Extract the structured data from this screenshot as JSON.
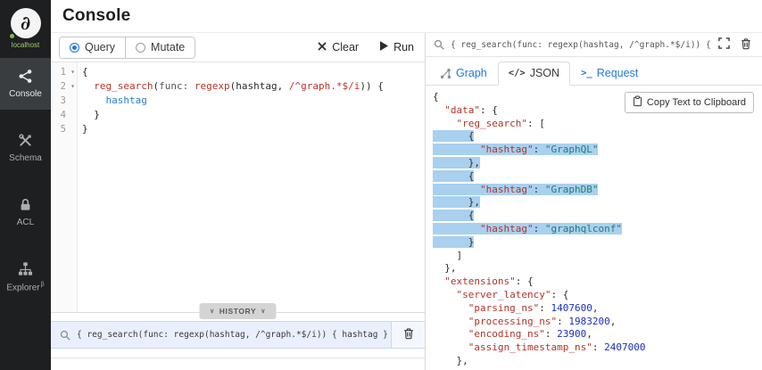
{
  "header": {
    "title": "Console"
  },
  "sidebar": {
    "server_label": "localhost",
    "items": [
      {
        "id": "console",
        "label": "Console",
        "icon": "share-network-icon",
        "active": true
      },
      {
        "id": "schema",
        "label": "Schema",
        "icon": "tools-icon",
        "active": false
      },
      {
        "id": "acl",
        "label": "ACL",
        "icon": "lock-icon",
        "active": false
      },
      {
        "id": "explorer",
        "label": "Explorer",
        "icon": "sitemap-icon",
        "active": false,
        "badge": "β"
      }
    ]
  },
  "toolbar": {
    "query_label": "Query",
    "mutate_label": "Mutate",
    "clear_label": "Clear",
    "run_label": "Run"
  },
  "editor": {
    "lines": [
      {
        "num": 1,
        "fold": true,
        "toks": [
          [
            "p",
            "{"
          ]
        ]
      },
      {
        "num": 2,
        "fold": true,
        "toks": [
          [
            "p",
            "  "
          ],
          [
            "d",
            "reg_search"
          ],
          [
            "p",
            "("
          ],
          [
            "a",
            "func:"
          ],
          [
            "p",
            " "
          ],
          [
            "d",
            "regexp"
          ],
          [
            "p",
            "(hashtag, "
          ],
          [
            "r",
            "/^graph.*$/i"
          ],
          [
            "p",
            ")) {"
          ]
        ]
      },
      {
        "num": 3,
        "fold": false,
        "toks": [
          [
            "p",
            "    "
          ],
          [
            "b",
            "hashtag"
          ]
        ]
      },
      {
        "num": 4,
        "fold": false,
        "toks": [
          [
            "p",
            "  }"
          ]
        ]
      },
      {
        "num": 5,
        "fold": false,
        "toks": [
          [
            "p",
            "}"
          ]
        ]
      }
    ]
  },
  "history": {
    "toggle_label": "HISTORY",
    "entries": [
      {
        "query": "{ reg_search(func: regexp(hashtag, /^graph.*$/i)) { hashtag } }",
        "active": true
      }
    ]
  },
  "results": {
    "query": "{ reg_search(func: regexp(hashtag, /^graph.*$/i)) { hashtag } }",
    "tabs": [
      {
        "id": "graph",
        "label": "Graph",
        "active": false,
        "icon": "graph-icon"
      },
      {
        "id": "json",
        "label": "JSON",
        "active": true,
        "glyph": "</>"
      },
      {
        "id": "request",
        "label": "Request",
        "active": false,
        "glyph": ">_"
      }
    ],
    "copy_label": "Copy Text to Clipboard",
    "json_lines": [
      {
        "hl": false,
        "toks": [
          [
            "p",
            "{"
          ]
        ]
      },
      {
        "hl": false,
        "toks": [
          [
            "p",
            "  "
          ],
          [
            "k",
            "\"data\""
          ],
          [
            "p",
            ": {"
          ]
        ]
      },
      {
        "hl": false,
        "toks": [
          [
            "p",
            "    "
          ],
          [
            "k",
            "\"reg_search\""
          ],
          [
            "p",
            ": ["
          ]
        ]
      },
      {
        "hl": true,
        "toks": [
          [
            "p",
            "      {"
          ]
        ]
      },
      {
        "hl": true,
        "toks": [
          [
            "p",
            "        "
          ],
          [
            "k",
            "\"hashtag\""
          ],
          [
            "p",
            ": "
          ],
          [
            "s",
            "\"GraphQL\""
          ]
        ]
      },
      {
        "hl": true,
        "toks": [
          [
            "p",
            "      },"
          ]
        ]
      },
      {
        "hl": true,
        "toks": [
          [
            "p",
            "      {"
          ]
        ]
      },
      {
        "hl": true,
        "toks": [
          [
            "p",
            "        "
          ],
          [
            "k",
            "\"hashtag\""
          ],
          [
            "p",
            ": "
          ],
          [
            "s",
            "\"GraphDB\""
          ]
        ]
      },
      {
        "hl": true,
        "toks": [
          [
            "p",
            "      },"
          ]
        ]
      },
      {
        "hl": true,
        "toks": [
          [
            "p",
            "      {"
          ]
        ]
      },
      {
        "hl": true,
        "toks": [
          [
            "p",
            "        "
          ],
          [
            "k",
            "\"hashtag\""
          ],
          [
            "p",
            ": "
          ],
          [
            "s",
            "\"graphqlconf\""
          ]
        ]
      },
      {
        "hl": true,
        "toks": [
          [
            "p",
            "      }"
          ]
        ]
      },
      {
        "hl": false,
        "toks": [
          [
            "p",
            "    ]"
          ]
        ]
      },
      {
        "hl": false,
        "toks": [
          [
            "p",
            "  },"
          ]
        ]
      },
      {
        "hl": false,
        "toks": [
          [
            "p",
            "  "
          ],
          [
            "k",
            "\"extensions\""
          ],
          [
            "p",
            ": {"
          ]
        ]
      },
      {
        "hl": false,
        "toks": [
          [
            "p",
            "    "
          ],
          [
            "k",
            "\"server_latency\""
          ],
          [
            "p",
            ": {"
          ]
        ]
      },
      {
        "hl": false,
        "toks": [
          [
            "p",
            "      "
          ],
          [
            "k",
            "\"parsing_ns\""
          ],
          [
            "p",
            ": "
          ],
          [
            "n",
            "1407600"
          ],
          [
            "p",
            ","
          ]
        ]
      },
      {
        "hl": false,
        "toks": [
          [
            "p",
            "      "
          ],
          [
            "k",
            "\"processing_ns\""
          ],
          [
            "p",
            ": "
          ],
          [
            "n",
            "1983200"
          ],
          [
            "p",
            ","
          ]
        ]
      },
      {
        "hl": false,
        "toks": [
          [
            "p",
            "      "
          ],
          [
            "k",
            "\"encoding_ns\""
          ],
          [
            "p",
            ": "
          ],
          [
            "n",
            "23900"
          ],
          [
            "p",
            ","
          ]
        ]
      },
      {
        "hl": false,
        "toks": [
          [
            "p",
            "      "
          ],
          [
            "k",
            "\"assign_timestamp_ns\""
          ],
          [
            "p",
            ": "
          ],
          [
            "n",
            "2407000"
          ]
        ]
      },
      {
        "hl": false,
        "toks": [
          [
            "p",
            "    },"
          ]
        ]
      }
    ]
  },
  "icons": {
    "chevron_down": "∨",
    "fold_open": "▾",
    "logo_glyph": "∂"
  },
  "colors": {
    "accent_blue": "#2377e4",
    "link_blue": "#2178e0",
    "selection_blue": "#a9d0ef",
    "connected_green": "#7ac143",
    "sidebar_bg": "#1d1f21",
    "key_red": "#b0342b",
    "string_teal": "#1f7e72",
    "number_blue": "#1c2fbd"
  }
}
